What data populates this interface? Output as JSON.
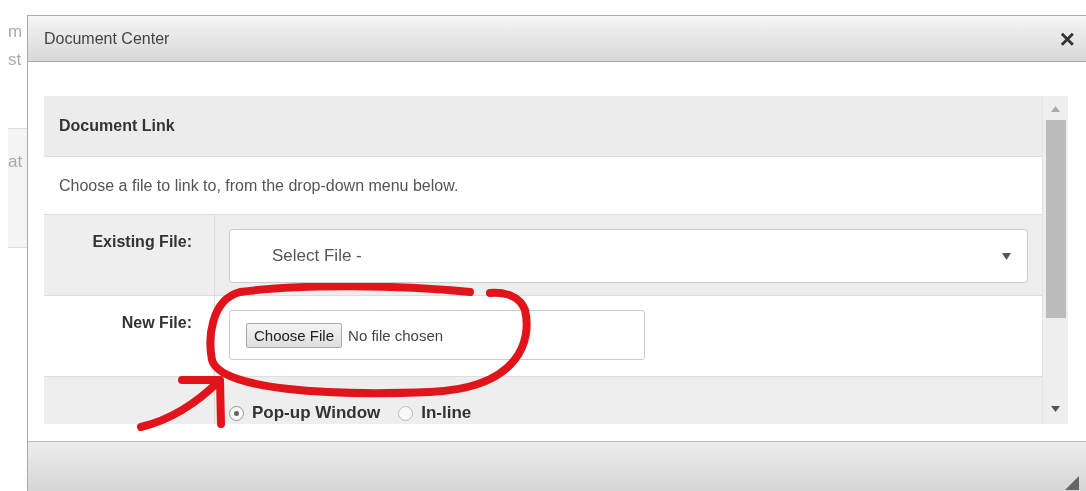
{
  "background_fragments": [
    "m",
    "st",
    "at"
  ],
  "window": {
    "title": "Document Center",
    "close": "×"
  },
  "panel": {
    "heading": "Document Link",
    "description": "Choose a file to link to, from the drop-down menu below.",
    "existing_file": {
      "label": "Existing File:",
      "placeholder": "Select File -"
    },
    "new_file": {
      "label": "New File:",
      "button": "Choose File",
      "status": "No file chosen"
    },
    "display_options": [
      {
        "label": "Pop-up Window",
        "selected": true
      },
      {
        "label": "In-line",
        "selected": false
      }
    ]
  }
}
